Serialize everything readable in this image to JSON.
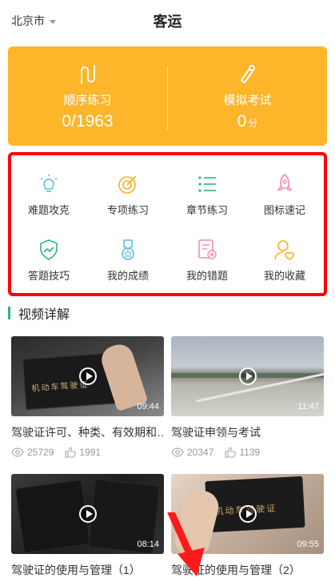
{
  "header": {
    "city": "北京市",
    "title": "客运"
  },
  "hero": {
    "left": {
      "label": "顺序练习",
      "value": "0/1963"
    },
    "right": {
      "label": "模拟考试",
      "value": "0",
      "unit": "分"
    }
  },
  "grid": [
    {
      "label": "难题攻克",
      "icon": "lightbulb-icon"
    },
    {
      "label": "专项练习",
      "icon": "target-icon"
    },
    {
      "label": "章节练习",
      "icon": "list-icon"
    },
    {
      "label": "图标速记",
      "icon": "rocket-icon"
    },
    {
      "label": "答题技巧",
      "icon": "shield-trend-icon"
    },
    {
      "label": "我的成绩",
      "icon": "medal-icon"
    },
    {
      "label": "我的错题",
      "icon": "error-doc-icon"
    },
    {
      "label": "我的收藏",
      "icon": "user-heart-icon"
    }
  ],
  "section": {
    "title": "视频详解"
  },
  "videos": [
    {
      "title": "驾驶证许可、种类、有效期和…",
      "duration": "09:44",
      "views": "25729",
      "likes": "1991",
      "card_text": "机动车驾驶证"
    },
    {
      "title": "驾驶证申领与考试",
      "duration": "11:47",
      "views": "20347",
      "likes": "1139"
    },
    {
      "title": "驾驶证的使用与管理（1）",
      "duration": "08:14"
    },
    {
      "title": "驾驶证的使用与管理（2）",
      "duration": "09:55",
      "card_text": "机动车驾驶证"
    }
  ],
  "colors": {
    "accent": "#fdb52a",
    "highlight": "#ff0000",
    "green": "#2fb57a"
  }
}
